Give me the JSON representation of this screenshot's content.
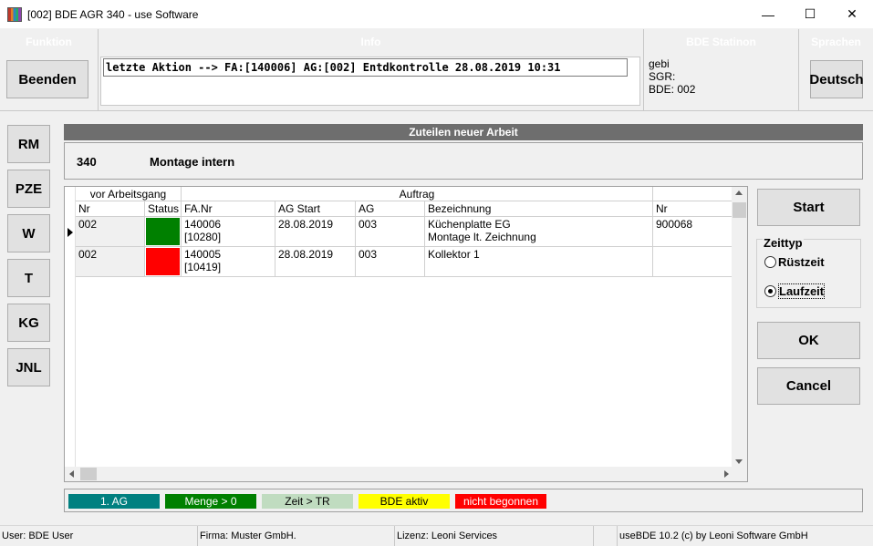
{
  "window": {
    "title": "[002] BDE AGR 340 - use Software",
    "minimize": "—",
    "maximize": "☐",
    "close": "✕"
  },
  "top": {
    "funktion_title": "Funktion",
    "beenden_label": "Beenden",
    "info_title": "Info",
    "info_text": "letzte Aktion --> FA:[140006] AG:[002] Entdkontrolle 28.08.2019 10:31",
    "station_title": "BDE Statinon",
    "station_lines": [
      "gebi",
      "SGR:",
      "BDE: 002"
    ],
    "sprachen_title": "Sprachen",
    "language_label": "Deutsch"
  },
  "leftnav": [
    "RM",
    "PZE",
    "W",
    "T",
    "KG",
    "JNL"
  ],
  "main": {
    "header": "Zuteilen neuer Arbeit",
    "sub_number": "340",
    "sub_name": "Montage intern"
  },
  "grid": {
    "group_prev": "vor Arbeitsgang",
    "group_order": "Auftrag",
    "columns": [
      "Nr",
      "Status",
      "FA.Nr",
      "AG Start",
      "AG",
      "Bezeichnung",
      "Nr"
    ],
    "rows": [
      {
        "nr": "002",
        "status_color": "#008000",
        "fa_nr": "140006",
        "fa_sub": "[10280]",
        "ag_start": "28.08.2019",
        "ag": "003",
        "bez1": "Küchenplatte EG",
        "bez2": "Montage lt. Zeichnung",
        "nr2": "900068",
        "current": true
      },
      {
        "nr": "002",
        "status_color": "#ff0000",
        "fa_nr": "140005",
        "fa_sub": "[10419]",
        "ag_start": "28.08.2019",
        "ag": "003",
        "bez1": "Kollektor 1",
        "bez2": "",
        "nr2": "",
        "current": false
      }
    ]
  },
  "right": {
    "start_label": "Start",
    "zeittyp_label": "Zeittyp",
    "ruestzeit_label": "Rüstzeit",
    "laufzeit_label": "Laufzeit",
    "selected": "Laufzeit",
    "ok_label": "OK",
    "cancel_label": "Cancel"
  },
  "legend": [
    {
      "label": "1. AG",
      "bg": "#008080",
      "fg": "#ffffff"
    },
    {
      "label": "Menge > 0",
      "bg": "#008000",
      "fg": "#ffffff"
    },
    {
      "label": "Zeit > TR",
      "bg": "#c0dcc0",
      "fg": "#000000"
    },
    {
      "label": "BDE aktiv",
      "bg": "#ffff00",
      "fg": "#000000"
    },
    {
      "label": "nicht begonnen",
      "bg": "#ff0000",
      "fg": "#ffffff"
    }
  ],
  "status": {
    "user": "User: BDE User",
    "firma": "Firma: Muster GmbH.",
    "lizenz": "Lizenz: Leoni Services",
    "empty": "",
    "version": "useBDE 10.2 (c) by Leoni Software GmbH"
  }
}
